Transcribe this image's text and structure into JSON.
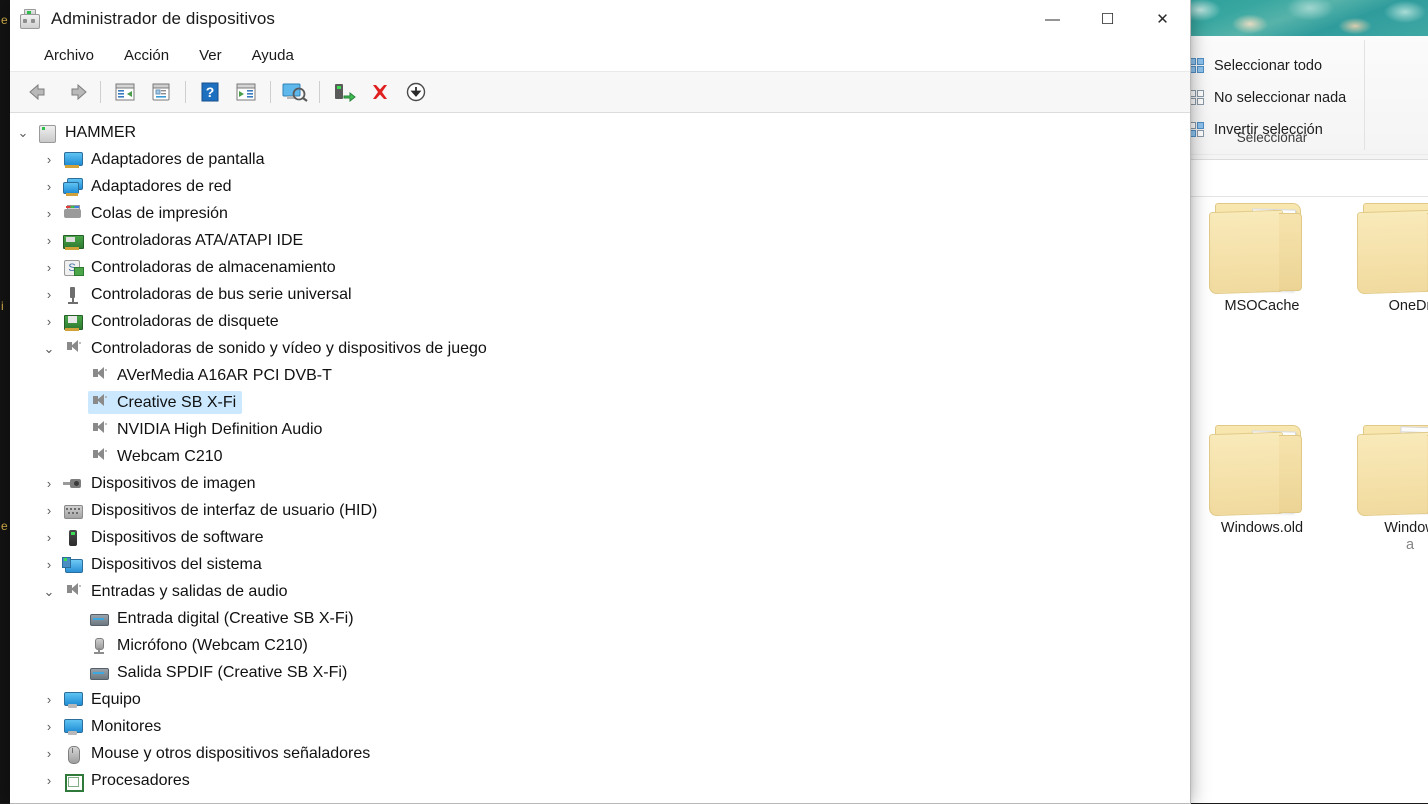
{
  "window": {
    "title": "Administrador de dispositivos",
    "app_icon": "device-manager-icon",
    "controls": {
      "minimize": "—",
      "maximize": "☐",
      "close": "✕"
    }
  },
  "menubar": {
    "items": [
      {
        "label": "Archivo",
        "name": "menu-archivo"
      },
      {
        "label": "Acción",
        "name": "menu-accion"
      },
      {
        "label": "Ver",
        "name": "menu-ver"
      },
      {
        "label": "Ayuda",
        "name": "menu-ayuda"
      }
    ]
  },
  "toolbar": {
    "buttons": [
      {
        "icon": "back-arrow-icon",
        "name": "toolbar-back"
      },
      {
        "icon": "forward-arrow-icon",
        "name": "toolbar-forward"
      },
      {
        "icon": "show-hide-console-tree-icon",
        "name": "toolbar-console-tree"
      },
      {
        "icon": "properties-icon",
        "name": "toolbar-properties"
      },
      {
        "icon": "help-icon",
        "name": "toolbar-help"
      },
      {
        "icon": "show-hide-action-pane-icon",
        "name": "toolbar-action-pane"
      },
      {
        "icon": "scan-hardware-changes-icon",
        "name": "toolbar-scan-hardware"
      },
      {
        "icon": "update-driver-icon",
        "name": "toolbar-update-driver"
      },
      {
        "icon": "uninstall-device-icon",
        "name": "toolbar-uninstall"
      },
      {
        "icon": "disable-device-icon",
        "name": "toolbar-disable"
      }
    ]
  },
  "tree": {
    "root": {
      "label": "HAMMER",
      "icon": "computer-icon",
      "expanded": true
    },
    "nodes": [
      {
        "label": "Adaptadores de pantalla",
        "icon": "display-adapter-icon",
        "level": 1,
        "state": "collapsed"
      },
      {
        "label": "Adaptadores de red",
        "icon": "network-adapter-icon",
        "level": 1,
        "state": "collapsed"
      },
      {
        "label": "Colas de impresión",
        "icon": "print-queue-icon",
        "level": 1,
        "state": "collapsed"
      },
      {
        "label": "Controladoras ATA/ATAPI IDE",
        "icon": "ide-controller-icon",
        "level": 1,
        "state": "collapsed"
      },
      {
        "label": "Controladoras de almacenamiento",
        "icon": "storage-controller-icon",
        "level": 1,
        "state": "collapsed"
      },
      {
        "label": "Controladoras de bus serie universal",
        "icon": "usb-controller-icon",
        "level": 1,
        "state": "collapsed"
      },
      {
        "label": "Controladoras de disquete",
        "icon": "floppy-controller-icon",
        "level": 1,
        "state": "collapsed"
      },
      {
        "label": "Controladoras de sonido y vídeo y dispositivos de juego",
        "icon": "sound-device-icon",
        "level": 1,
        "state": "expanded"
      },
      {
        "label": "AVerMedia A16AR PCI DVB-T",
        "icon": "sound-device-icon",
        "level": 2,
        "state": "leaf"
      },
      {
        "label": "Creative SB X-Fi",
        "icon": "sound-device-icon",
        "level": 2,
        "state": "leaf",
        "selected": true
      },
      {
        "label": "NVIDIA High Definition Audio",
        "icon": "sound-device-icon",
        "level": 2,
        "state": "leaf"
      },
      {
        "label": "Webcam C210",
        "icon": "sound-device-icon",
        "level": 2,
        "state": "leaf"
      },
      {
        "label": "Dispositivos de imagen",
        "icon": "imaging-device-icon",
        "level": 1,
        "state": "collapsed"
      },
      {
        "label": "Dispositivos de interfaz de usuario (HID)",
        "icon": "hid-device-icon",
        "level": 1,
        "state": "collapsed"
      },
      {
        "label": "Dispositivos de software",
        "icon": "software-device-icon",
        "level": 1,
        "state": "collapsed"
      },
      {
        "label": "Dispositivos del sistema",
        "icon": "system-device-icon",
        "level": 1,
        "state": "collapsed"
      },
      {
        "label": "Entradas y salidas de audio",
        "icon": "sound-device-icon",
        "level": 1,
        "state": "expanded"
      },
      {
        "label": "Entrada digital (Creative SB X-Fi)",
        "icon": "audio-endpoint-icon",
        "level": 2,
        "state": "leaf"
      },
      {
        "label": "Micrófono (Webcam C210)",
        "icon": "microphone-icon",
        "level": 2,
        "state": "leaf"
      },
      {
        "label": "Salida SPDIF (Creative SB X-Fi)",
        "icon": "audio-endpoint-icon",
        "level": 2,
        "state": "leaf"
      },
      {
        "label": "Equipo",
        "icon": "computer-device-icon",
        "level": 1,
        "state": "collapsed"
      },
      {
        "label": "Monitores",
        "icon": "monitor-icon",
        "level": 1,
        "state": "collapsed"
      },
      {
        "label": "Mouse y otros dispositivos señaladores",
        "icon": "mouse-icon",
        "level": 1,
        "state": "collapsed"
      },
      {
        "label": "Procesadores",
        "icon": "processor-icon",
        "level": 1,
        "state": "collapsed"
      }
    ],
    "chevron_collapsed": "›",
    "chevron_expanded": "⌄",
    "selection_color": "#cce8ff"
  },
  "explorer": {
    "ribbon": {
      "group_label": "Seleccionar",
      "items": [
        {
          "label": "Seleccionar todo",
          "name": "ribbon-select-all",
          "icon": "select-all-icon"
        },
        {
          "label": "No seleccionar nada",
          "name": "ribbon-select-none",
          "icon": "select-none-icon"
        },
        {
          "label": "Invertir selección",
          "name": "ribbon-invert-selection",
          "icon": "invert-selection-icon"
        }
      ]
    },
    "folders": [
      {
        "label": "MSOCache",
        "name": "folder-msocache",
        "art": "folder-with-document",
        "truncated": false
      },
      {
        "label": "OneDr",
        "name": "folder-onedrive",
        "art": "folder-plain",
        "truncated": true
      },
      {
        "label": "Windows.old",
        "name": "folder-windows-old",
        "art": "folder-with-document",
        "truncated": false
      },
      {
        "label": "Window",
        "label2": "a",
        "name": "folder-windows-other",
        "art": "folder-with-stack",
        "truncated": true
      }
    ]
  },
  "colors": {
    "selection": "#cce8ff",
    "accent": "#0078d7",
    "wallpaper": "#2e9e9a",
    "folder": "#f5e0a0"
  }
}
